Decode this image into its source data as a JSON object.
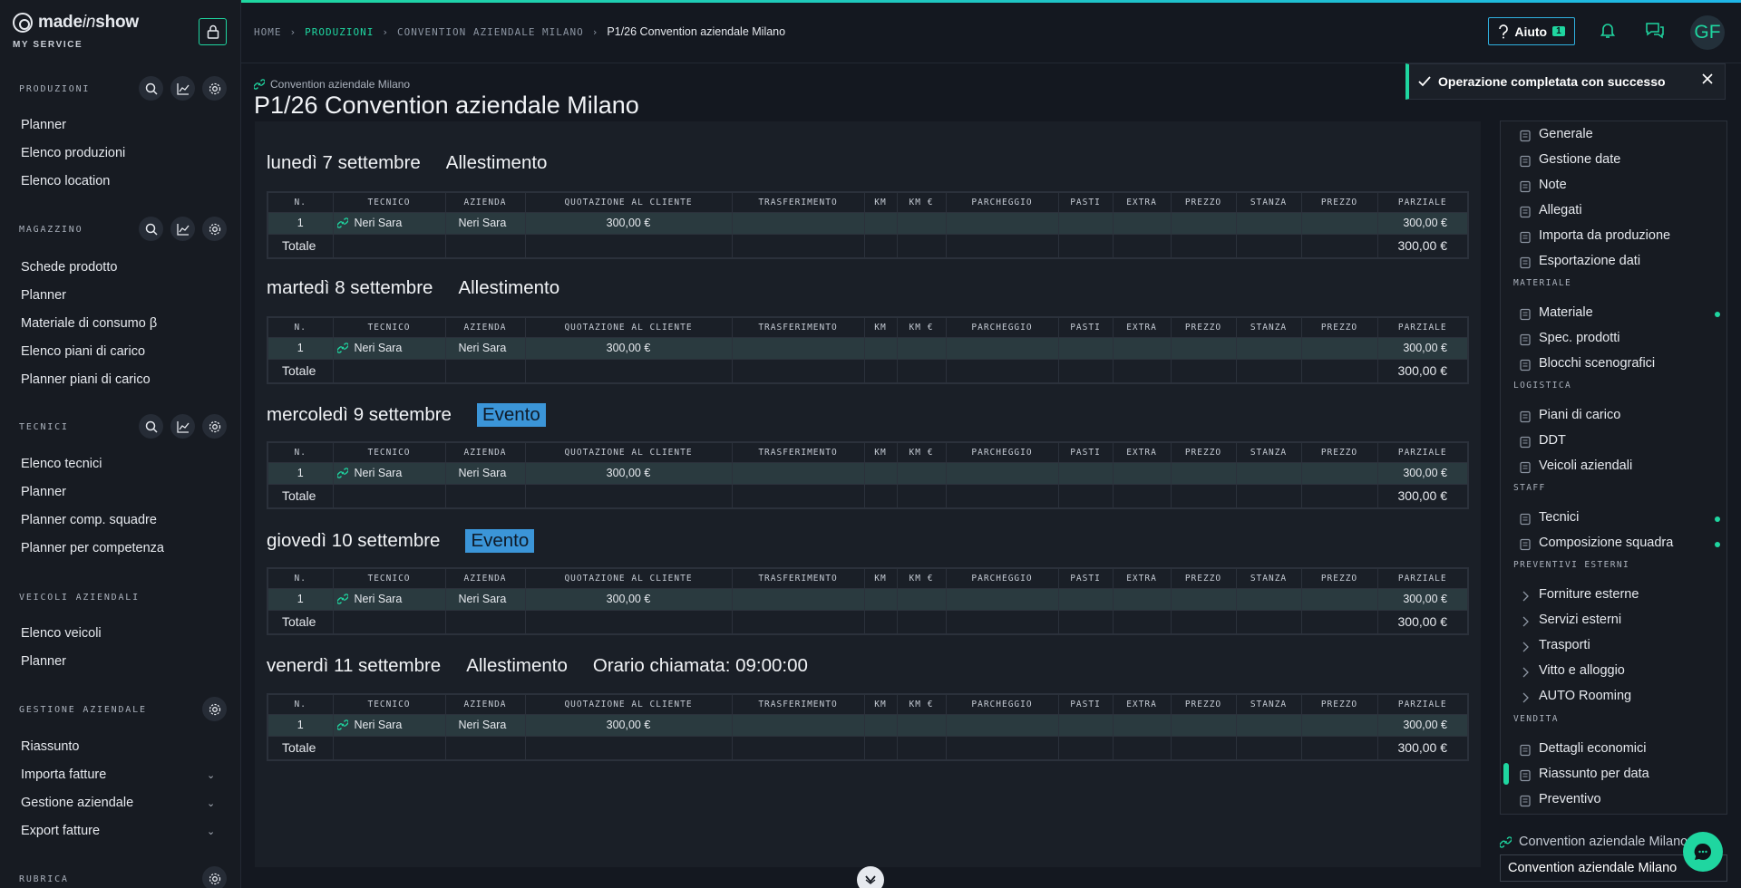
{
  "brand": {
    "name_prefix": "made",
    "name_italic": "in",
    "name_suffix": "show",
    "subtitle": "MY SERVICE"
  },
  "sidebar": {
    "sections": [
      {
        "title": "PRODUZIONI",
        "items": [
          "Planner",
          "Elenco produzioni",
          "Elenco location"
        ]
      },
      {
        "title": "MAGAZZINO",
        "items": [
          "Schede prodotto",
          "Planner",
          "Materiale di consumo β",
          "Elenco piani di carico",
          "Planner piani di carico"
        ]
      },
      {
        "title": "TECNICI",
        "items": [
          "Elenco tecnici",
          "Planner",
          "Planner comp. squadre",
          "Planner per competenza"
        ]
      },
      {
        "title": "VEICOLI AZIENDALI",
        "items": [
          "Elenco veicoli",
          "Planner"
        ]
      },
      {
        "title": "GESTIONE AZIENDALE",
        "items": [
          "Riassunto",
          "Importa fatture",
          "Gestione aziendale",
          "Export fatture"
        ]
      },
      {
        "title": "RUBRICA",
        "items": []
      }
    ]
  },
  "breadcrumb": [
    "HOME",
    "PRODUZIONI",
    "CONVENTION AZIENDALE MILANO",
    "P1/26 Convention aziendale Milano"
  ],
  "header": {
    "help_label": "Aiuto",
    "help_badge": "1",
    "avatar": "GF"
  },
  "toast": {
    "message": "Operazione completata con successo"
  },
  "page": {
    "parent_link": "Convention aziendale Milano",
    "title": "P1/26 Convention aziendale Milano"
  },
  "table": {
    "columns": [
      "N.",
      "TECNICO",
      "AZIENDA",
      "QUOTAZIONE AL CLIENTE",
      "TRASFERIMENTO",
      "KM",
      "KM €",
      "PARCHEGGIO",
      "PASTI",
      "EXTRA",
      "PREZZO",
      "STANZA",
      "PREZZO",
      "PARZIALE"
    ],
    "total_label": "Totale"
  },
  "days": [
    {
      "date": "lunedì 7 settembre",
      "phase": "Allestimento",
      "event": false,
      "extra": "",
      "row": {
        "n": "1",
        "tecnico": "Neri Sara",
        "azienda": "Neri Sara",
        "quotazione": "300,00 €",
        "parziale": "300,00 €"
      },
      "total": "300,00 €"
    },
    {
      "date": "martedì 8 settembre",
      "phase": "Allestimento",
      "event": false,
      "extra": "",
      "row": {
        "n": "1",
        "tecnico": "Neri Sara",
        "azienda": "Neri Sara",
        "quotazione": "300,00 €",
        "parziale": "300,00 €"
      },
      "total": "300,00 €"
    },
    {
      "date": "mercoledì 9 settembre",
      "phase": "Evento",
      "event": true,
      "extra": "",
      "row": {
        "n": "1",
        "tecnico": "Neri Sara",
        "azienda": "Neri Sara",
        "quotazione": "300,00 €",
        "parziale": "300,00 €"
      },
      "total": "300,00 €"
    },
    {
      "date": "giovedì 10 settembre",
      "phase": "Evento",
      "event": true,
      "extra": "",
      "row": {
        "n": "1",
        "tecnico": "Neri Sara",
        "azienda": "Neri Sara",
        "quotazione": "300,00 €",
        "parziale": "300,00 €"
      },
      "total": "300,00 €"
    },
    {
      "date": "venerdì 11 settembre",
      "phase": "Allestimento",
      "event": false,
      "extra": "Orario chiamata: 09:00:00",
      "row": {
        "n": "1",
        "tecnico": "Neri Sara",
        "azienda": "Neri Sara",
        "quotazione": "300,00 €",
        "parziale": "300,00 €"
      },
      "total": "300,00 €"
    }
  ],
  "right_nav": {
    "items_top": [
      "Generale",
      "Gestione date",
      "Note",
      "Allegati",
      "Importa da produzione",
      "Esportazione dati"
    ],
    "materiale_title": "MATERIALE",
    "materiale": [
      "Materiale",
      "Spec. prodotti",
      "Blocchi scenografici"
    ],
    "logistica_title": "LOGISTICA",
    "logistica": [
      "Piani di carico",
      "DDT",
      "Veicoli aziendali"
    ],
    "staff_title": "STAFF",
    "staff": [
      "Tecnici",
      "Composizione squadra"
    ],
    "preventivi_title": "PREVENTIVI ESTERNI",
    "preventivi": [
      "Forniture esterne",
      "Servizi esterni",
      "Trasporti",
      "Vitto e alloggio",
      "AUTO Rooming"
    ],
    "vendita_title": "VENDITA",
    "vendita": [
      "Dettagli economici",
      "Riassunto per data",
      "Preventivo"
    ]
  },
  "bottom": {
    "link": "Convention aziendale Milano",
    "field_value": "Convention aziendale Milano"
  },
  "colors": {
    "accent": "#1fd6a0",
    "event": "#3b95d8",
    "background": "#141820"
  }
}
